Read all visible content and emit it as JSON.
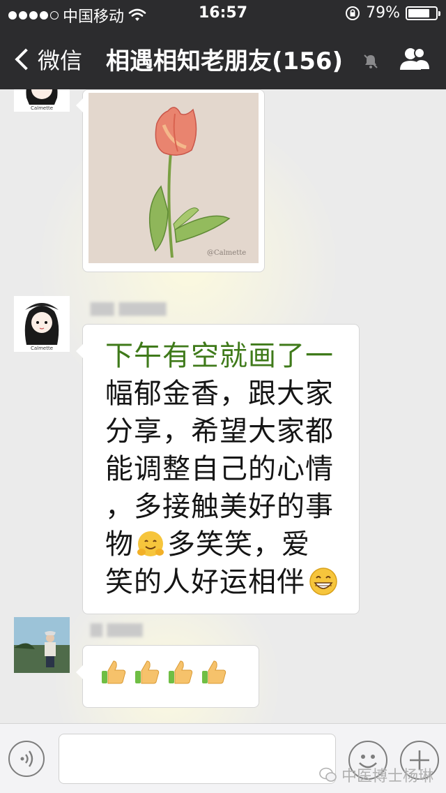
{
  "status_bar": {
    "carrier": "中国移动",
    "time": "16:57",
    "battery_percent": "79%",
    "battery_level": 0.79,
    "signal_bars_filled": 4
  },
  "nav": {
    "back_label": "微信",
    "title": "相遇相知老朋友(156)"
  },
  "messages": [
    {
      "type": "image",
      "image_credit": "@Calmette"
    },
    {
      "type": "text",
      "lines": [
        "下午有空就画了一",
        "幅郁金香，跟大家",
        "分享，希望大家都",
        "能调整自己的心情",
        "，多接触美好的事",
        "物",
        "多笑笑，爱",
        "笑的人好运相伴"
      ]
    },
    {
      "type": "emoji",
      "emoji": [
        "thumbs-up",
        "thumbs-up",
        "thumbs-up",
        "thumbs-up"
      ]
    }
  ],
  "avatar_caption": "Calmette",
  "watermark": "中医博士杨琳",
  "colors": {
    "nav_background": "#2c2c2e",
    "chat_background": "#ebebeb",
    "first_line_text": "#3f7a1a"
  }
}
